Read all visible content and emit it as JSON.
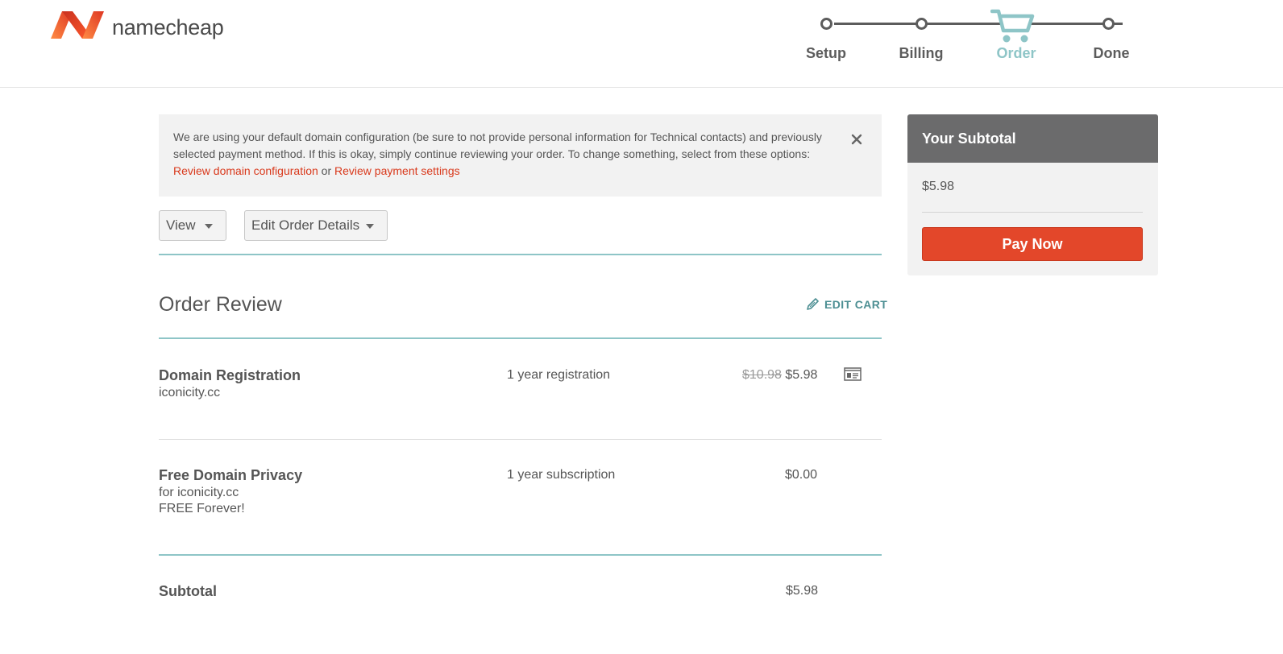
{
  "brand": {
    "name": "namecheap",
    "logo_colors": [
      "#ff8c44",
      "#de3723"
    ]
  },
  "steps": [
    {
      "label": "Setup",
      "active": false
    },
    {
      "label": "Billing",
      "active": false
    },
    {
      "label": "Order",
      "active": true
    },
    {
      "label": "Done",
      "active": false
    }
  ],
  "notice": {
    "text_before": "We are using your default domain configuration (be sure to not provide personal information for Technical contacts) and previously selected payment method. If this is okay, simply continue reviewing your order. To change something, select from these options: ",
    "link_domain": "Review domain configuration",
    "or": " or ",
    "link_payment": "Review payment settings",
    "close_icon": "close-icon"
  },
  "controls": {
    "view_label": "View",
    "edit_order_label": "Edit Order Details"
  },
  "order": {
    "title": "Order Review",
    "edit_cart_label": "EDIT CART",
    "items": [
      {
        "name": "Domain Registration",
        "sub": [
          "iconicity.cc"
        ],
        "term": "1 year registration",
        "old_price": "$10.98",
        "price": "$5.98",
        "icon": "contact-card-icon"
      },
      {
        "name": "Free Domain Privacy",
        "sub": [
          "for iconicity.cc",
          "FREE Forever!"
        ],
        "term": "1 year subscription",
        "price": "$0.00"
      }
    ],
    "subtotal_label": "Subtotal",
    "subtotal_value": "$5.98"
  },
  "sidebar": {
    "title": "Your Subtotal",
    "amount": "$5.98",
    "pay_label": "Pay Now"
  },
  "colors": {
    "accent_teal": "#8ec5c7",
    "pay_red": "#e3472a",
    "link_red": "#d9391c"
  }
}
